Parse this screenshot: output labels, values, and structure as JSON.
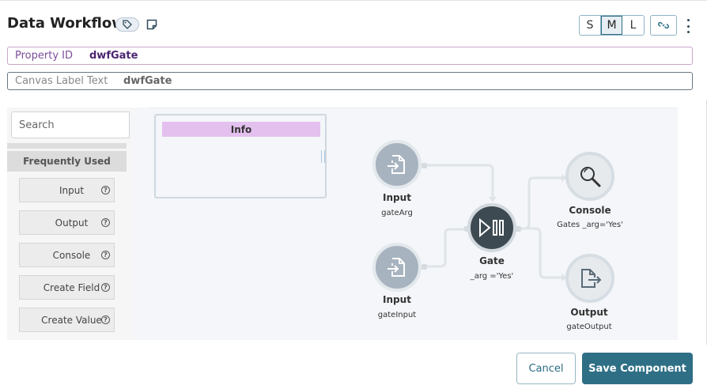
{
  "header": {
    "title": "Data Workflow",
    "size_options": [
      {
        "label": "S",
        "active": false
      },
      {
        "label": "M",
        "active": true
      },
      {
        "label": "L",
        "active": false
      }
    ]
  },
  "fields": {
    "property_id": {
      "label": "Property ID",
      "value": "dwfGate"
    },
    "canvas_label": {
      "label": "Canvas Label Text",
      "value": "dwfGate"
    }
  },
  "palette": {
    "search_placeholder": "Search",
    "section_title": "Frequently Used",
    "items": [
      {
        "label": "Input"
      },
      {
        "label": "Output"
      },
      {
        "label": "Console"
      },
      {
        "label": "Create Field"
      },
      {
        "label": "Create Value"
      }
    ],
    "help_glyph": "?"
  },
  "canvas": {
    "info_title": "Info",
    "nodes": [
      {
        "id": "input1",
        "title": "Input",
        "sub": "gateArg",
        "icon": "file-import-icon"
      },
      {
        "id": "input2",
        "title": "Input",
        "sub": "gateInput",
        "icon": "file-import-icon"
      },
      {
        "id": "gate",
        "title": "Gate",
        "sub": "_arg ='Yes'",
        "icon": "gate-play-pause-icon"
      },
      {
        "id": "console",
        "title": "Console",
        "sub": "Gates _arg='Yes'",
        "icon": "magnifier-icon"
      },
      {
        "id": "output",
        "title": "Output",
        "sub": "gateOutput",
        "icon": "file-export-icon"
      }
    ]
  },
  "footer": {
    "cancel_label": "Cancel",
    "save_label": "Save Component"
  },
  "colors": {
    "primary": "#2f6f86",
    "info_header": "#e4c0ef",
    "node_gray": "#a7b3bf",
    "node_dark": "#3e4a52"
  }
}
